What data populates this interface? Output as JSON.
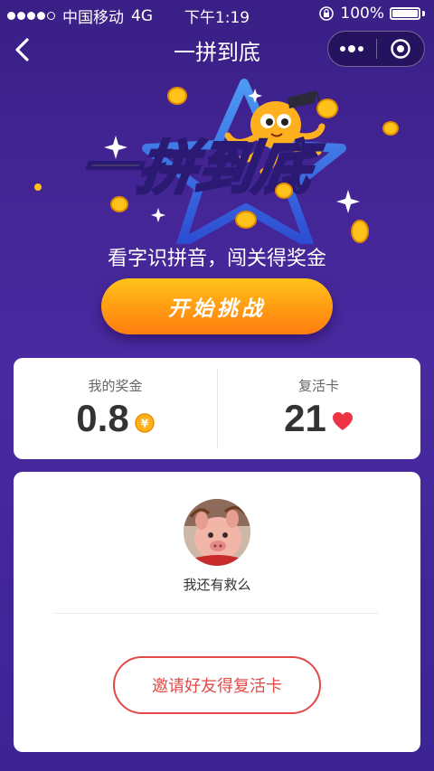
{
  "status_bar": {
    "carrier": "中国移动",
    "network": "4G",
    "time": "下午1:19",
    "battery": "100%"
  },
  "nav": {
    "title": "一拼到底",
    "more_icon": "more-dots-icon",
    "close_icon": "target-close-icon"
  },
  "hero": {
    "logo_text": "一拼到底",
    "subtitle": "看字识拼音，闯关得奖金",
    "start_button": "开始挑战"
  },
  "stats": {
    "reward_label": "我的奖金",
    "reward_value": "0.8",
    "reward_currency": "¥",
    "revive_label": "复活卡",
    "revive_value": "21"
  },
  "friend": {
    "name": "我还有救么",
    "invite_button": "邀请好友得复活卡"
  },
  "colors": {
    "background": "#3f238f",
    "button_orange": "#ff9a12",
    "accent_red": "#e24a48"
  }
}
